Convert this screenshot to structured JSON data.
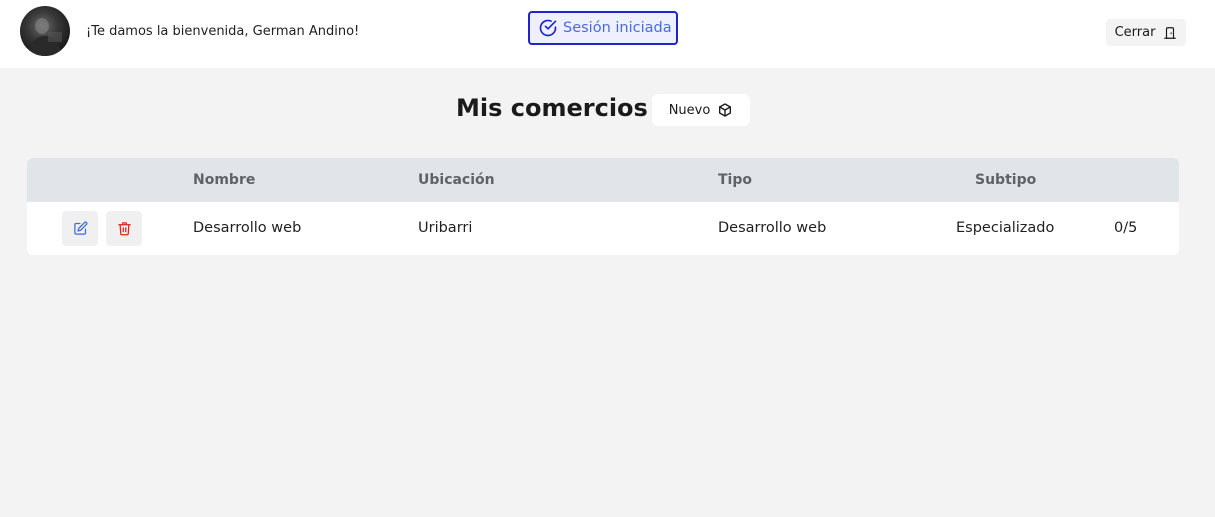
{
  "header": {
    "welcome_text": "¡Te damos la bienvenida, German Andino!",
    "session_label": "Sesión iniciada",
    "close_label": "Cerrar",
    "avatar_icon": "user-photo",
    "session_icon": "check-circle-icon",
    "close_icon": "door-icon"
  },
  "main": {
    "title": "Mis comercios",
    "new_button_label": "Nuevo",
    "new_button_icon": "cube-icon"
  },
  "table": {
    "columns": [
      "Nombre",
      "Ubicación",
      "Tipo",
      "Subtipo"
    ],
    "rows": [
      {
        "nombre": "Desarrollo web",
        "ubicacion": "Uribarri",
        "tipo": "Desarrollo web",
        "subtipo": "Especializado",
        "rating": "0/5",
        "edit_icon": "edit-icon",
        "delete_icon": "trash-icon"
      }
    ]
  },
  "colors": {
    "accent_blue": "#1f23c9",
    "session_text": "#4a6be0",
    "edit_icon": "#3b6fd8",
    "delete_icon": "#e0201f",
    "table_header_bg": "#e1e4e8",
    "page_bg": "#f3f3f3"
  }
}
